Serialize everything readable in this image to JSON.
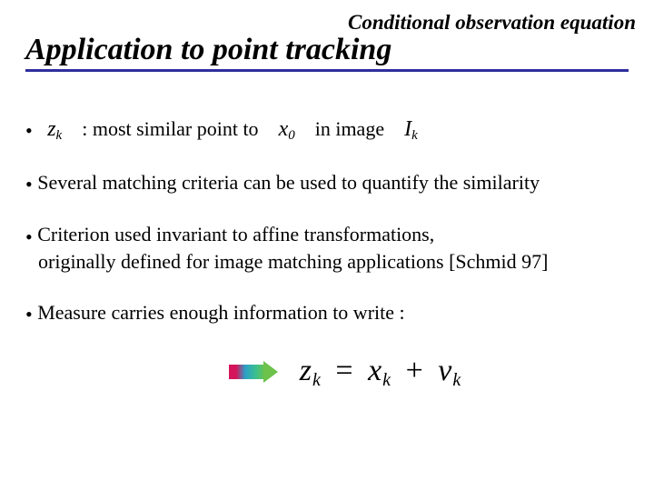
{
  "header": "Conditional observation equation",
  "title": "Application to point tracking",
  "bullets": {
    "b1_part1": ": most similar point to",
    "b1_part2": "in image",
    "b2": "Several matching criteria can be used to quantify the similarity",
    "b3_line1": "Criterion used invariant to affine transformations,",
    "b3_line2": "originally defined for image matching applications [Schmid 97]",
    "b4": "Measure carries enough information to write :"
  },
  "math": {
    "zk_base": "z",
    "zk_sub": "k",
    "x0_base": "x",
    "x0_sub": "0",
    "Ik_base": "I",
    "Ik_sub": "k",
    "eq_z_base": "z",
    "eq_z_sub": "k",
    "eq_eq": "=",
    "eq_x_base": "x",
    "eq_x_sub": "k",
    "eq_plus": "+",
    "eq_v_base": "v",
    "eq_v_sub": "k"
  }
}
